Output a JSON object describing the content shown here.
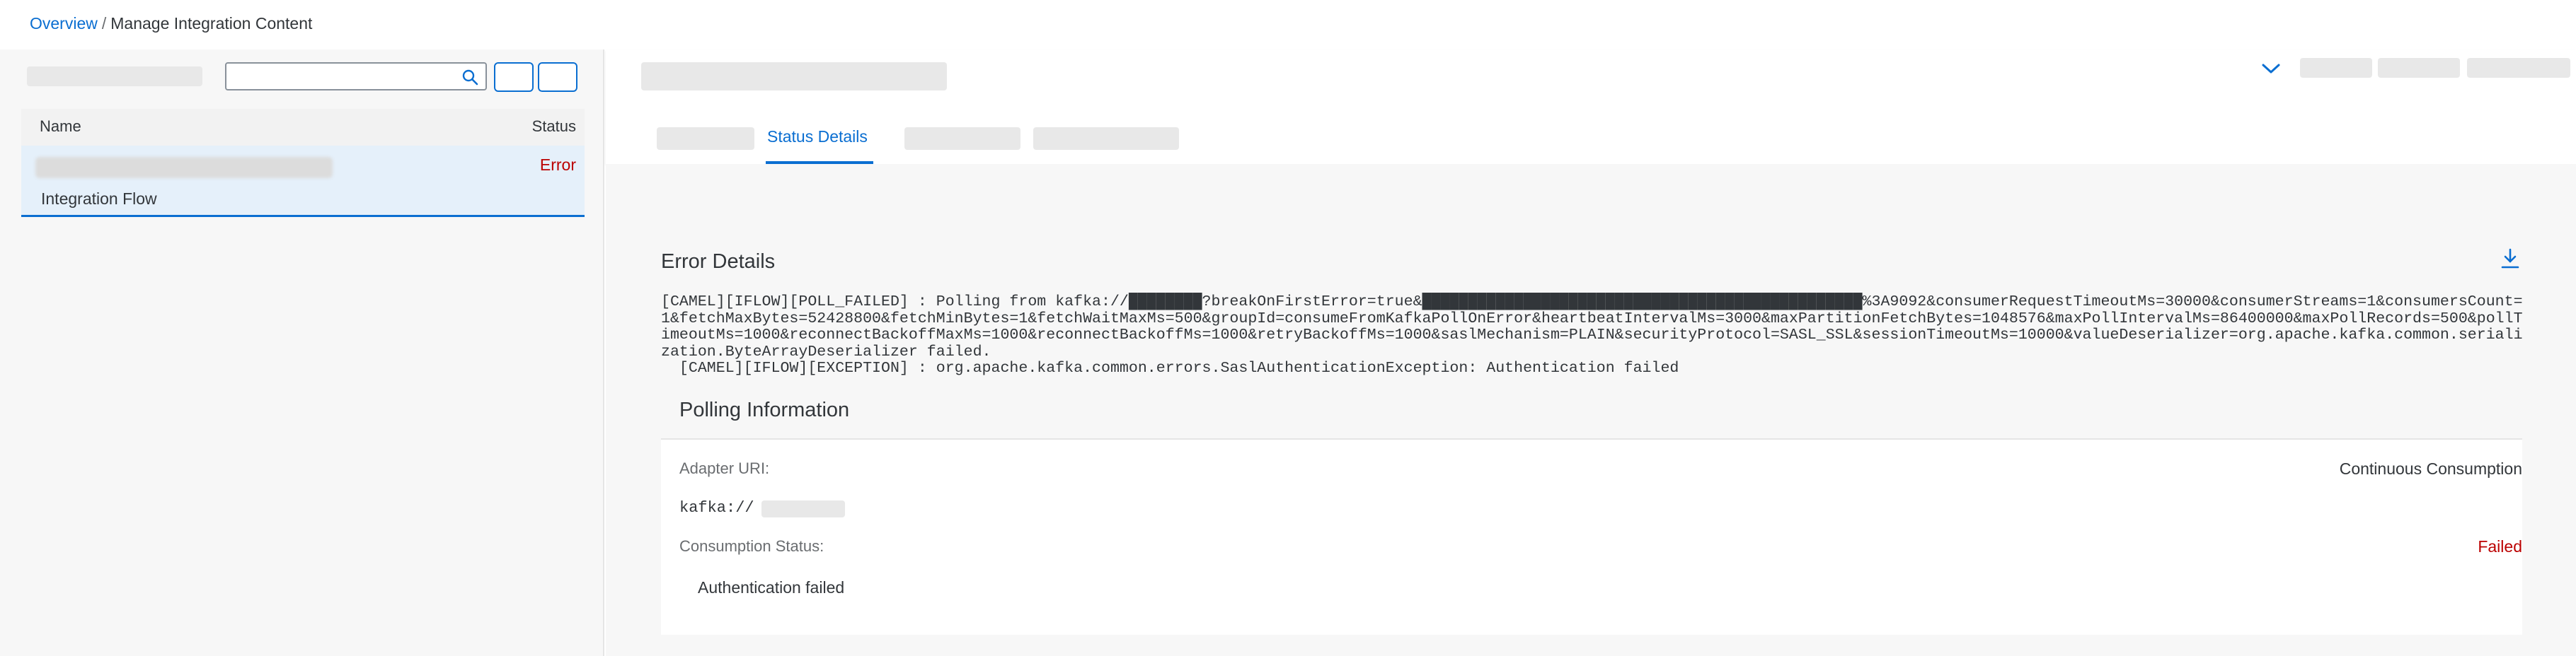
{
  "breadcrumb": {
    "overview": "Overview",
    "separator": "/",
    "current": "Manage Integration Content"
  },
  "search": {
    "placeholder": ""
  },
  "list": {
    "headers": {
      "name": "Name",
      "status": "Status"
    },
    "rows": [
      {
        "status": "Error",
        "type": "Integration Flow"
      }
    ]
  },
  "tabs": {
    "selected": "Status Details"
  },
  "error_details": {
    "title": "Error Details",
    "text": "[CAMEL][IFLOW][POLL_FAILED] : Polling from kafka://████████?breakOnFirstError=true&████████████████████████████████████████████████%3A9092&consumerRequestTimeoutMs=30000&consumerStreams=1&consumersCount=1&fetchMaxBytes=52428800&fetchMinBytes=1&fetchWaitMaxMs=500&groupId=consumeFromKafkaPollOnError&heartbeatIntervalMs=3000&maxPartitionFetchBytes=1048576&maxPollIntervalMs=86400000&maxPollRecords=500&pollTimeoutMs=1000&reconnectBackoffMaxMs=1000&reconnectBackoffMs=1000&retryBackoffMs=1000&saslMechanism=PLAIN&securityProtocol=SASL_SSL&sessionTimeoutMs=10000&valueDeserializer=org.apache.kafka.common.serialization.ByteArrayDeserializer failed.\n  [CAMEL][IFLOW][EXCEPTION] : org.apache.kafka.common.errors.SaslAuthenticationException: Authentication failed"
  },
  "polling": {
    "title": "Polling Information",
    "adapter_uri_label": "Adapter URI:",
    "mode": "Continuous Consumption",
    "uri_prefix": "kafka://",
    "consumption_status_label": "Consumption Status:",
    "consumption_status": "Failed",
    "message": "Authentication failed"
  },
  "colors": {
    "accent": "#0a6ed1",
    "error": "#bb0000",
    "selection": "#e5f0fa"
  },
  "icons": {
    "search": "search-icon",
    "collapse": "chevron-down-icon",
    "download": "download-icon"
  }
}
